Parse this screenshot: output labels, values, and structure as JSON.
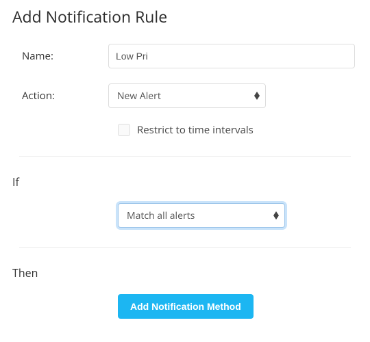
{
  "title": "Add Notification Rule",
  "form": {
    "name_label": "Name:",
    "name_value": "Low Pri",
    "action_label": "Action:",
    "action_value": "New Alert",
    "restrict_label": "Restrict to time intervals",
    "restrict_checked": false
  },
  "if_section": {
    "heading": "If",
    "match_value": "Match all alerts"
  },
  "then_section": {
    "heading": "Then",
    "add_button_label": "Add Notification Method"
  }
}
